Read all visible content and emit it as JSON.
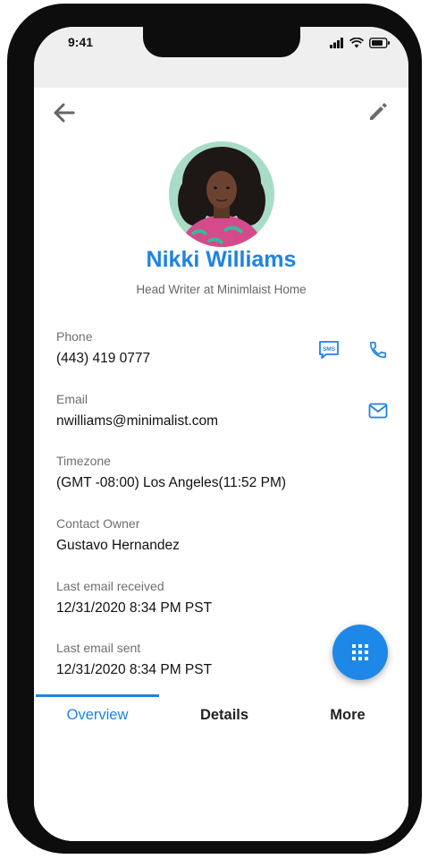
{
  "status_bar": {
    "time": "9:41"
  },
  "contact": {
    "name": "Nikki Williams",
    "subtitle": "Head Writer at Minimlaist Home"
  },
  "fields": {
    "phone": {
      "label": "Phone",
      "value": "(443) 419 0777"
    },
    "email": {
      "label": "Email",
      "value": "nwilliams@minimalist.com"
    },
    "timezone": {
      "label": "Timezone",
      "value": "(GMT -08:00) Los Angeles(11:52 PM)"
    },
    "owner": {
      "label": "Contact Owner",
      "value": "Gustavo Hernandez"
    },
    "last_received": {
      "label": "Last email received",
      "value": "12/31/2020 8:34 PM PST"
    },
    "last_sent": {
      "label": "Last email sent",
      "value": "12/31/2020 8:34 PM PST"
    }
  },
  "tabs": [
    {
      "label": "Overview",
      "active": true
    },
    {
      "label": "Details",
      "active": false
    },
    {
      "label": "More",
      "active": false
    }
  ],
  "icons": {
    "sms": "sms-icon",
    "sms_text": "SMS",
    "phone": "phone-icon",
    "mail": "mail-icon",
    "fab": "grid-icon"
  },
  "colors": {
    "accent": "#1f83e0",
    "fab": "#1e88e8",
    "status_bar_bg": "#efefef"
  }
}
